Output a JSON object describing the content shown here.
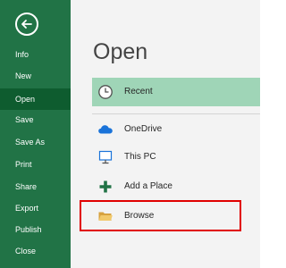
{
  "sidebar": {
    "back_icon": "back-arrow-icon",
    "items": [
      {
        "label": "Info"
      },
      {
        "label": "New"
      },
      {
        "label": "Open"
      },
      {
        "label": "Save"
      },
      {
        "label": "Save As"
      },
      {
        "label": "Print"
      },
      {
        "label": "Share"
      },
      {
        "label": "Export"
      },
      {
        "label": "Publish"
      },
      {
        "label": "Close"
      }
    ],
    "active_item": "Open"
  },
  "main": {
    "title": "Open",
    "locations": [
      {
        "label": "Recent",
        "icon": "clock-icon"
      },
      {
        "label": "OneDrive",
        "icon": "cloud-icon"
      },
      {
        "label": "This PC",
        "icon": "computer-icon"
      },
      {
        "label": "Add a Place",
        "icon": "plus-icon"
      },
      {
        "label": "Browse",
        "icon": "folder-icon"
      }
    ]
  },
  "colors": {
    "sidebar_bg": "#217346",
    "active_item_bg": "#0e5c2f",
    "selected_location_bg": "#9fd5b7",
    "highlight_border": "#e00000"
  }
}
